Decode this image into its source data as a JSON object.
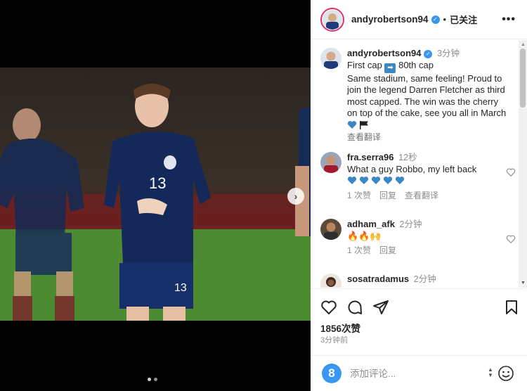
{
  "post": {
    "username": "andyrobertson94",
    "follow_status": "已关注",
    "header_separator": "•",
    "more_label": "•••"
  },
  "caption": {
    "username": "andyrobertson94",
    "time": "3分钟",
    "line_first_cap": "First cap",
    "line_80th_cap": "80th cap",
    "text": "Same stadium, same feeling! Proud to join the legend Darren Fletcher as third most capped. The win was the cherry on top of the cake, see you all in March",
    "translate": "查看翻译"
  },
  "comments": [
    {
      "username": "fra.serra96",
      "time": "12秒",
      "text": "What a guy Robbo, my left back",
      "likes": "1 次赞",
      "reply": "回复",
      "translate": "查看翻译"
    },
    {
      "username": "adham_afk",
      "time": "2分钟",
      "text": "🔥🔥🙌",
      "likes": "1 次赞",
      "reply": "回复"
    },
    {
      "username": "sosatradamus",
      "time": "2分钟",
      "text": ""
    }
  ],
  "actions": {
    "likes_count": "1856次赞",
    "post_time": "3分钟前"
  },
  "composer": {
    "avatar_letter": "8",
    "placeholder": "添加评论..."
  },
  "colors": {
    "accent_blue": "#3897f0",
    "story_ring": "#e1306c",
    "heart_blue": "#3b88c3"
  },
  "media": {
    "carousel_count": 2,
    "carousel_active": 1
  }
}
